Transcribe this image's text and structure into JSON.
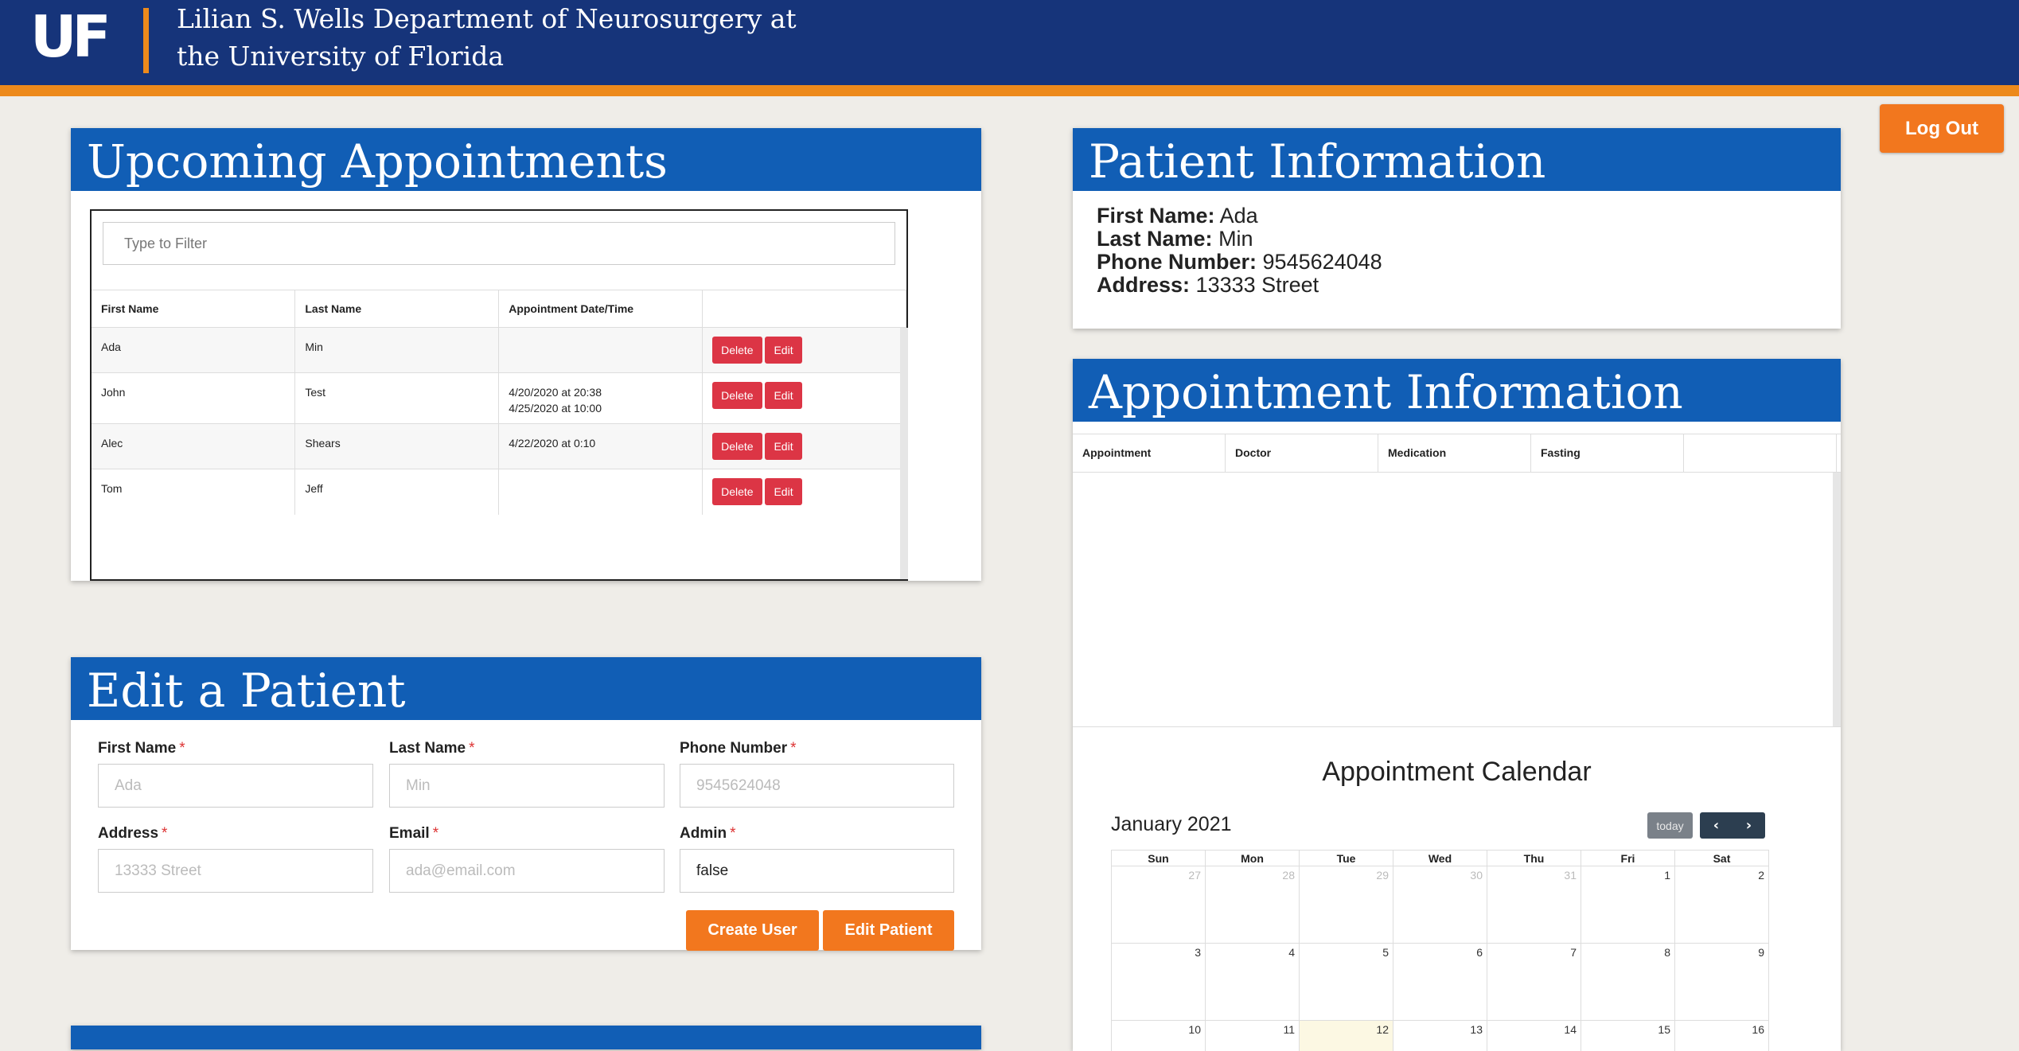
{
  "header": {
    "logo_text": "UF",
    "department_line1": "Lilian S. Wells Department of Neurosurgery at",
    "department_line2": "the University of Florida",
    "logout_label": "Log Out"
  },
  "upcoming": {
    "title": "Upcoming Appointments",
    "filter_placeholder": "Type to Filter",
    "columns": [
      "First Name",
      "Last Name",
      "Appointment Date/Time",
      ""
    ],
    "rows": [
      {
        "first": "Ada",
        "last": "Min",
        "times": [
          "",
          ""
        ]
      },
      {
        "first": "John",
        "last": "Test",
        "times": [
          "4/20/2020 at 20:38",
          "4/25/2020 at 10:00"
        ]
      },
      {
        "first": "Alec",
        "last": "Shears",
        "times": [
          "4/22/2020 at 0:10",
          ""
        ]
      },
      {
        "first": "Tom",
        "last": "Jeff",
        "times": [
          "",
          ""
        ]
      }
    ],
    "delete_label": "Delete",
    "edit_label": "Edit"
  },
  "edit_patient": {
    "title": "Edit a Patient",
    "first_name_label": "First Name",
    "last_name_label": "Last Name",
    "phone_label": "Phone Number",
    "address_label": "Address",
    "email_label": "Email",
    "admin_label": "Admin",
    "required_mark": "*",
    "first_name_placeholder": "Ada",
    "last_name_placeholder": "Min",
    "phone_placeholder": "9545624048",
    "address_placeholder": "13333 Street",
    "email_placeholder": "ada@email.com",
    "admin_value": "false",
    "create_user_label": "Create User",
    "edit_patient_label": "Edit Patient"
  },
  "patient_info": {
    "title": "Patient Information",
    "first_name_label": "First Name:",
    "first_name": "Ada",
    "last_name_label": "Last Name:",
    "last_name": "Min",
    "phone_label": "Phone Number:",
    "phone": "9545624048",
    "address_label": "Address:",
    "address": "13333 Street"
  },
  "appointment_info": {
    "title": "Appointment Information",
    "columns": [
      "Appointment",
      "Doctor",
      "Medication",
      "Fasting",
      ""
    ]
  },
  "calendar": {
    "title": "Appointment Calendar",
    "month": "January 2021",
    "today_label": "today",
    "prev_icon": "chevron-left",
    "next_icon": "chevron-right",
    "weekdays": [
      "Sun",
      "Mon",
      "Tue",
      "Wed",
      "Thu",
      "Fri",
      "Sat"
    ],
    "weeks": [
      [
        "27",
        "28",
        "29",
        "30",
        "31",
        "1",
        "2"
      ],
      [
        "3",
        "4",
        "5",
        "6",
        "7",
        "8",
        "9"
      ],
      [
        "10",
        "11",
        "12",
        "13",
        "14",
        "15",
        "16"
      ]
    ],
    "today_date": "12"
  }
}
